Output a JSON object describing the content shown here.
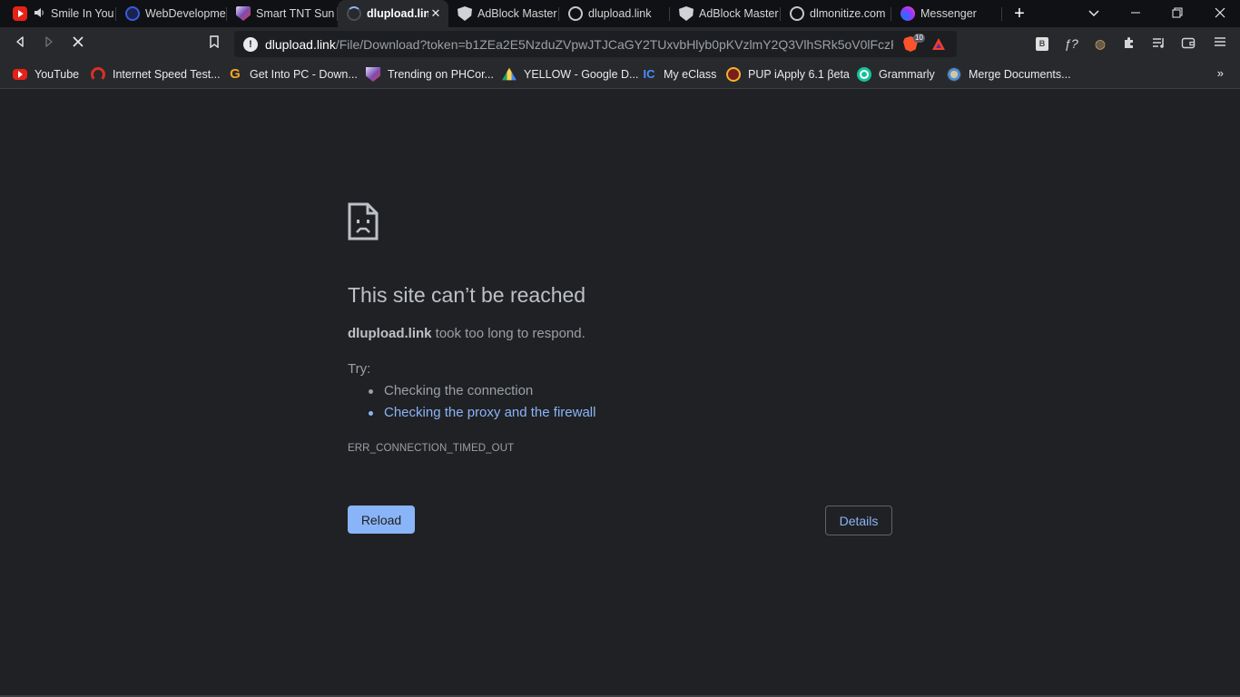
{
  "tabs": [
    {
      "title": "Smile In You",
      "favicon": "youtube-icon"
    },
    {
      "title": "WebDevelopme",
      "favicon": "globe-icon"
    },
    {
      "title": "Smart TNT Sun",
      "favicon": "phcorner-icon"
    },
    {
      "title": "dlupload.link",
      "favicon": "loading-spinner-icon",
      "active": true
    },
    {
      "title": "AdBlock Master",
      "favicon": "shield-icon"
    },
    {
      "title": "dlupload.link",
      "favicon": "globe-icon"
    },
    {
      "title": "AdBlock Master",
      "favicon": "shield-icon"
    },
    {
      "title": "dlmonitize.com",
      "favicon": "globe-icon"
    },
    {
      "title": "Messenger",
      "favicon": "messenger-icon"
    }
  ],
  "tab_close_glyph": "✕",
  "new_tab_glyph": "+",
  "window": {
    "minimize": "—",
    "restore": "❐",
    "close": "✕",
    "tab_search": "⌄"
  },
  "toolbar": {
    "back": "◁",
    "forward": "▷",
    "stop": "✕",
    "bookmark": "🔖",
    "info": "!",
    "url_host": "dlupload.link",
    "url_path": "/File/Download?token=b1ZEa2E5NzduZVpwJTJCaGY2TUxvbHlyb0pKVzlmY2Q3VlhSRk5oV0lFczR...",
    "brave_shields_count": "10",
    "extensions": {
      "b_ext": "B",
      "f_ext": "ƒ?",
      "cookie_ext": "◍",
      "puzzle": "✱",
      "playlist": "≡",
      "wallet": "▣",
      "menu": "≡"
    }
  },
  "bookmarks": [
    {
      "label": "YouTube",
      "icon": "youtube-icon"
    },
    {
      "label": "Internet Speed Test...",
      "icon": "speedometer-icon"
    },
    {
      "label": "Get Into PC - Down...",
      "icon": "g-logo-icon"
    },
    {
      "label": "Trending on PHCor...",
      "icon": "phcorner-icon"
    },
    {
      "label": "YELLOW - Google D...",
      "icon": "google-drive-icon"
    },
    {
      "label": "My eClass",
      "icon": "eclass-icon"
    },
    {
      "label": "PUP iApply 6.1 βeta",
      "icon": "pup-seal-icon"
    },
    {
      "label": "Grammarly",
      "icon": "grammarly-icon"
    },
    {
      "label": "Merge Documents...",
      "icon": "merge-icon"
    }
  ],
  "bookmarks_more": "»",
  "error_page": {
    "title": "This site can’t be reached",
    "host": "dlupload.link",
    "summary_suffix": " took too long to respond.",
    "try_label": "Try:",
    "suggestions": [
      {
        "text": "Checking the connection",
        "link": false
      },
      {
        "text": "Checking the proxy and the firewall",
        "link": true
      }
    ],
    "error_code": "ERR_CONNECTION_TIMED_OUT",
    "reload_label": "Reload",
    "details_label": "Details"
  },
  "colors": {
    "accent": "#8ab4f8",
    "background": "#202124",
    "toolbar": "#28292d",
    "tabstrip": "#101114"
  }
}
